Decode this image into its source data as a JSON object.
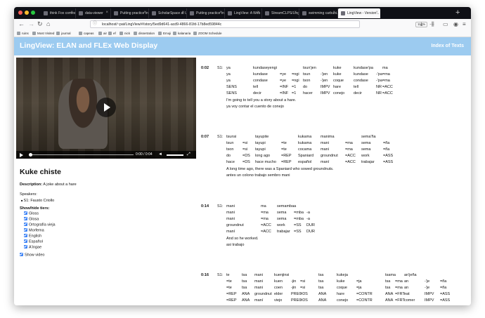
{
  "browser": {
    "tabs": [
      {
        "label": "think Fox comes to Burma...",
        "active": false
      },
      {
        "label": "data-viewer",
        "active": false
      },
      {
        "label": "Putting practice into...",
        "active": false
      },
      {
        "label": "ScholarSpace at Uni...",
        "active": false
      },
      {
        "label": "Putting practice into...",
        "active": false
      },
      {
        "label": "LingView: A Web Int...",
        "active": false
      },
      {
        "label": "StreamCLPS/LingVie...",
        "active": false
      },
      {
        "label": "swimming carbuoi...",
        "active": false
      },
      {
        "label": "LingView - Version...",
        "active": true
      }
    ],
    "new_tab_label": "+",
    "url": "localhost/~pat/LingView/#/story/5ed9d641-acd9-4866-81fd-17b8ed59844c",
    "zoom": "110%",
    "bookmarks": [
      "ruins",
      "Most Visited",
      "journal",
      "capeas",
      "air",
      "ef",
      "nick",
      "dissertation",
      "Emoji",
      "kalanaria",
      "ZOOM Schedule"
    ]
  },
  "app": {
    "title": "LingView: ELAN and FLEx Web Display",
    "index_link": "Index of Texts"
  },
  "video": {
    "time": "0:00 / 0:04"
  },
  "story": {
    "title": "Kuke chiste",
    "description_label": "Description:",
    "description": "A joke about a hare",
    "speakers_label": "Speakers:",
    "speakers": [
      "S1: Fausto Criollo"
    ],
    "tiers_label": "Show/hide tiers:",
    "tiers": [
      "Gloss",
      "Glosa",
      "Ortografía vieja",
      "Morfema",
      "English",
      "Español",
      "A'ingae"
    ],
    "show_video_label": "Show video"
  },
  "sentences": [
    {
      "time": "0:02",
      "speaker": "S1:",
      "words": [
        [
          "ya",
          "ya",
          "ya",
          "SENS",
          "SENS"
        ],
        [
          "kundaseyengi",
          "kundase",
          "condase",
          "tell",
          "decir"
        ],
        [
          "",
          "=ye",
          "=ye",
          "=INF",
          "=INF"
        ],
        [
          "",
          "=ngi",
          "=ngi",
          "=1",
          "=1"
        ],
        [
          "tsun'jen",
          "tsun",
          "tson",
          "do",
          "hacer"
        ],
        [
          "",
          "-'jen",
          "-'jen",
          "IMPV",
          "IMPV"
        ],
        [
          "kuke",
          "kuke",
          "coque",
          "hare",
          "conejo"
        ],
        [
          "kundase'pa",
          "kundase",
          "condase",
          "tell",
          "decir"
        ],
        [
          "",
          "-'pa",
          "-'pa",
          "NR",
          "NR"
        ],
        [
          "ma",
          "=ma",
          "=ma",
          "=ACC",
          "=ACC"
        ]
      ],
      "free": [
        "I'm going to tell you a story about a hare.",
        "ya voy contar el cuento de conejo"
      ]
    },
    {
      "time": "0:07",
      "speaker": "S1:",
      "words": [
        [
          "tsunsi",
          "tsun",
          "tson",
          "do",
          "hace"
        ],
        [
          "",
          "=si",
          "=si",
          "=DS",
          "=DS"
        ],
        [
          "tayupite",
          "tayupi",
          "tayupi",
          "long ago",
          "hace mucho"
        ],
        [
          "",
          "=te",
          "=te",
          "=REP",
          "=REP"
        ],
        [
          "kukama",
          "kukama",
          "cocama",
          "Spaniard",
          "español"
        ],
        [
          "manima",
          "mani",
          "mani",
          "groundnut",
          "maní"
        ],
        [
          "",
          "=ma",
          "=ma",
          "=ACC",
          "=ACC"
        ],
        [
          "sema'ña",
          "sema",
          "sema",
          "work",
          "trabajar"
        ],
        [
          "",
          "=ña",
          "=ña",
          "=ASS",
          "=ASS"
        ]
      ],
      "free": [
        "A long time ago, there was a Spaniard who sowed groundnuts.",
        "antes un colono trabajo sembro mani"
      ]
    },
    {
      "time": "0:14",
      "speaker": "S1:",
      "words": [
        [
          "mani",
          "mani",
          "mani",
          "groundnut",
          "maní"
        ],
        [
          "ma",
          "=ma",
          "=ma",
          "=ACC",
          "=ACC"
        ],
        [
          "semambaa",
          "sema",
          "sema",
          "work",
          "trabajar"
        ],
        [
          "",
          "=mba",
          "=mba",
          "=SS",
          "=SS"
        ],
        [
          "",
          "-a",
          "-a",
          "DUR",
          "DUR"
        ]
      ],
      "free": [
        "And so he worked.",
        "asi trabajo"
      ]
    },
    {
      "time": "0:16",
      "speaker": "S1:",
      "words": [
        [
          "te",
          "=te",
          "=te",
          "=REP",
          "=REP"
        ],
        [
          "tsa",
          "tsa",
          "tsa",
          "ANA",
          "ANA"
        ],
        [
          "mani",
          "mani",
          "mani",
          "groundnut",
          "maní"
        ],
        [
          "kuenjinsi",
          "kuen",
          "coen",
          "elder",
          "viejo"
        ],
        [
          "",
          "-jin",
          "-jin",
          "PREC",
          "PREC"
        ],
        [
          "",
          "=si",
          "=si",
          "=DS",
          "=DS"
        ],
        [
          "tsa",
          "tsa",
          "tsa",
          "ANA",
          "ANA"
        ],
        [
          "kukeja",
          "kuke",
          "coque",
          "hare",
          "conejo"
        ],
        [
          "",
          "=ja",
          "=ja",
          "=CONTR",
          "=CONTR"
        ],
        [
          "tsama",
          "tsa",
          "tsa",
          "ANA",
          "ANA"
        ],
        [
          "",
          "=ma",
          "=ma",
          "=FRT",
          "=FRT"
        ],
        [
          "an'jeña",
          "an",
          "an",
          "eat",
          "comer"
        ],
        [
          "",
          "-'je",
          "-'je",
          "IMPV",
          "IMPV"
        ],
        [
          "",
          "=ña",
          "=ña",
          "=ASS",
          "=ASS"
        ]
      ],
      "free": []
    }
  ]
}
